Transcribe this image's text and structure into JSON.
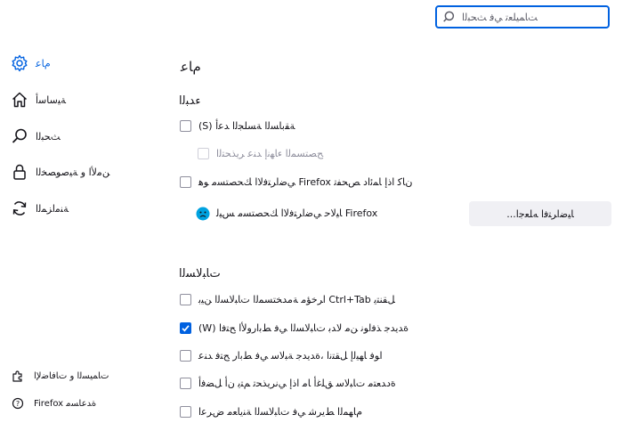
{
  "search": {
    "placeholder": "ﺖﺎﻤﻴﻠﻌﺗ ﻲﻓ ﺚﺤﺒﻟﺍ"
  },
  "sidebar": {
    "items": [
      {
        "label": "ﻡﺎﻋ",
        "icon": "gear-icon",
        "selected": true
      },
      {
        "label": "ﺔﻴﺳﺎﺳﺃ",
        "icon": "home-icon",
        "selected": false
      },
      {
        "label": "ﺚﺤﺒﻟﺍ",
        "icon": "search-icon",
        "selected": false
      },
      {
        "label": "ﻦﻣﻷﺍ ﻭ ﺔﻴﺻﻮﺼﺨﻟﺍ",
        "icon": "lock-icon",
        "selected": false
      },
      {
        "label": "ﺔﻨﻣﺍﺰﻤﻟﺍ",
        "icon": "sync-icon",
        "selected": false
      }
    ],
    "footer": [
      {
        "label": "ﺕﺎﻤﻴﺴﻟﺍ ﻭ ﺕﺎﻓﺎﺿﻹﺍ",
        "icon": "puzzle-icon"
      },
      {
        "label": "Firefox ﺓﺪﻋﺎﺴﻣ",
        "icon": "help-icon"
      }
    ]
  },
  "main": {
    "title": "ﻡﺎﻋ",
    "startup": {
      "heading": "ﺀﺪﺒﻟﺍ",
      "restore_session": "(‏S‏) ﺔﻘﺑﺎﺴﻟﺍ ﺔﺴﻠﺠﻟﺍ ﺪﻋﺃ",
      "warn_on_quit": "ﺢﺼﺘﺴﻤﻟﺍ ﺀﺎﻬﻧﺇ ﺪﻨﻋ ﺮﻳﺬﺤﺘﻟﺍ",
      "check_default": "ﻲﺿﺍﺮﺘﻓﻻﺍ ﻚﺤﺼﺘﺴﻣ ﻮﻫ Firefox ﻥﺎﻛ ﺍﺫﺇ ﺎﻤﺋﺍﺩ ﺺﺤﻔﺗ",
      "not_default": "ﺎﻴﻟﺎﺣ ﻲﺿﺍﺮﺘﻓﻻﺍ ﻚﺤﺼﺘﺴﻣ ﺲﻴﻟ Firefox",
      "make_default_button": "...ﺎﻴﺿﺍﺮﺘﻓﺍ ﻪﻠﻌﺟﺍ"
    },
    "tabs": {
      "heading": "ﺕﺎﺒﻟﺎﺴﻟﺍ",
      "ctrl_tab": "ﺍﺮﺧﺆﻣ ﺔﻣﺪﺨﺘﺴﻤﻟﺍ ﺕﺎﺒﻟﺎﺴﻟﺍ ﻦﻴﺑ Ctrl+Tab ﻞﻘﻨﺘﻳ",
      "open_links_in_tabs": "(‏W‏) ﺓﺪﻳﺪﺟ ﺬﻓﺍﻮﻧ ﻦﻣ ﻻﺪﺑ ﺕﺎﺒﻟﺎﺴﻟﺍ ﻲﻓ ﻂﺑﺍﺭﻭﻷﺍ ﺢﺘﻓﺍ",
      "switch_to_new_tab": "ﺍﻮﻓ ﺎﻬﻴﻟﺇ ﻞﻘﺘﻧﺍ ،ﺓﺪﻳﺪﺟ ﺔﺒﻟﺎﺳ ﻲﻓ ﻂﺑﺍﺭ ﺢﺘﻓ ﺪﻨﻋ",
      "warn_on_close": "ﺓﺩﺪﻌﺘﻣ ﺕﺎﺒﻟﺎﺳ ﻖﻠﻏﺃ ﺎﻣ ﺍﺫﺇ ﻲﻧﺮﻳﺬﺤﺗ ﻢﺘﻳ ﻥﺃ ﻞﻀﻓﺃ",
      "taskbar_previews": "ﻡﺎﻬﻤﻟﺍ ﻂﻳﺮﺷ ﻲﻓ ﺕﺎﺒﻟﺎﺴﻟﺍ ﺔﻨﻳﺎﻌﻣ ﺽﺮﻋﺍ"
    }
  },
  "colors": {
    "accent": "#0061e0",
    "text": "#15141a",
    "button_bg": "#f0f0f4"
  }
}
